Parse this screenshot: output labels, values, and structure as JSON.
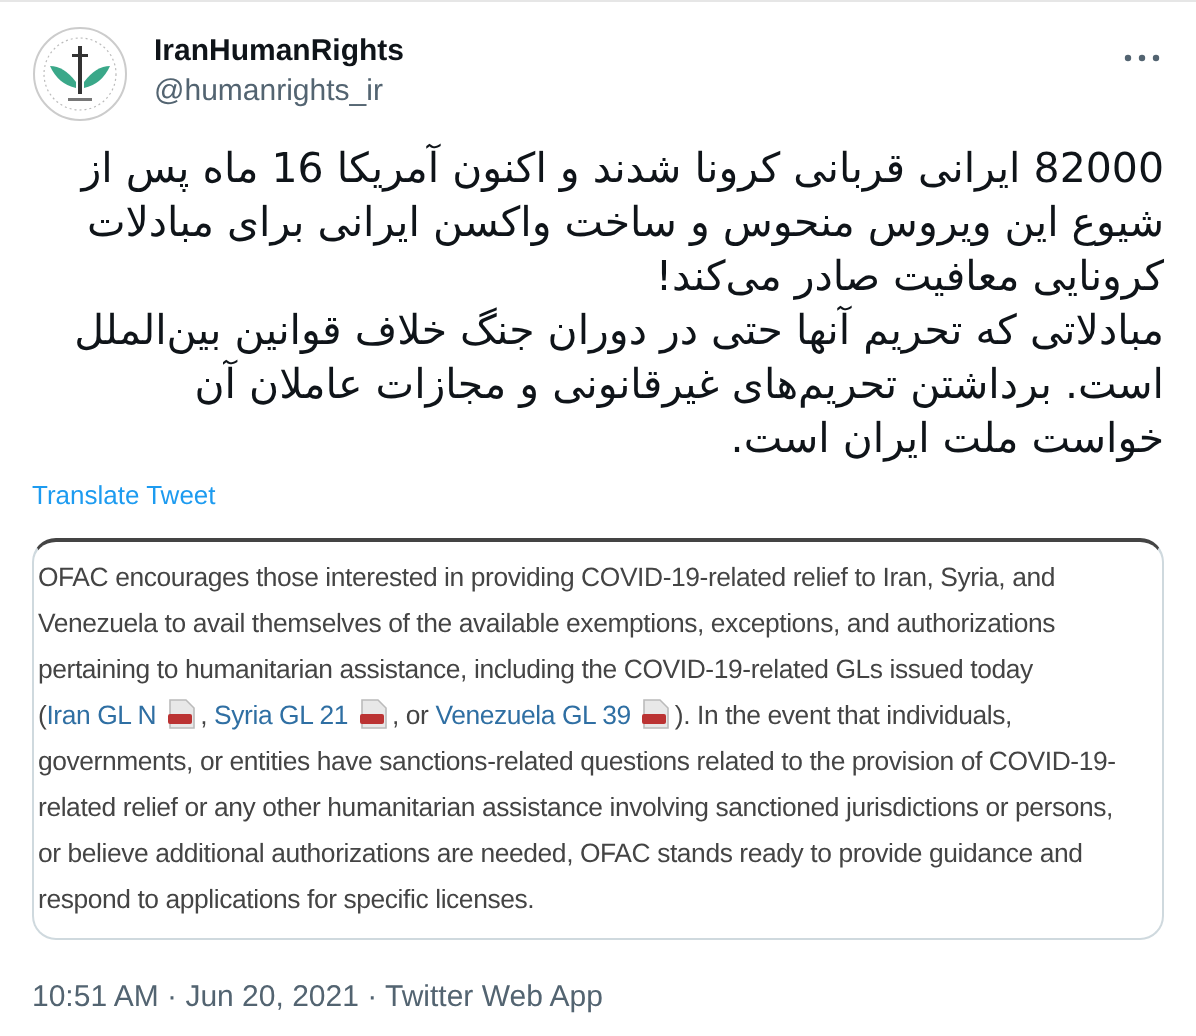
{
  "author": {
    "name": "IranHumanRights",
    "handle": "@humanrights_ir"
  },
  "tweet": {
    "paragraphs": [
      "82000 ایرانی قربانی کرونا شدند و اکنون آمریکا 16 ماه پس از شیوع این ویروس منحوس و ساخت واکسن ایرانی برای مبادلات کرونایی معافیت صادر می‌کند!",
      "مبادلاتی که تحریم آنها حتی در دوران جنگ خلاف قوانین بین‌الملل است. برداشتن تحریم‌های غیرقانونی و مجازات عاملان آن خواست ملت ایران است."
    ],
    "translate_link": "Translate Tweet"
  },
  "attached_image": {
    "segments": [
      {
        "kind": "text",
        "text": "OFAC encourages those interested in providing COVID-19-related relief to Iran, Syria, and Venezuela to avail themselves of the available exemptions, exceptions, and authorizations pertaining to humanitarian assistance, including the COVID-19-related GLs issued today ("
      },
      {
        "kind": "link",
        "text": "Iran GL N"
      },
      {
        "kind": "pdf"
      },
      {
        "kind": "text",
        "text": ", "
      },
      {
        "kind": "link",
        "text": "Syria GL 21"
      },
      {
        "kind": "pdf"
      },
      {
        "kind": "text",
        "text": ", or "
      },
      {
        "kind": "link",
        "text": "Venezuela GL 39"
      },
      {
        "kind": "pdf"
      },
      {
        "kind": "text",
        "text": ").  In the event that individuals, governments, or entities have sanctions-related questions related to the provision of COVID-19-related relief or any other humanitarian assistance involving sanctioned jurisdictions or persons, or believe additional authorizations are needed, OFAC stands ready to provide guidance and respond to applications for specific licenses."
      }
    ]
  },
  "timestamp": "10:51 AM · Jun 20, 2021 · Twitter Web App"
}
